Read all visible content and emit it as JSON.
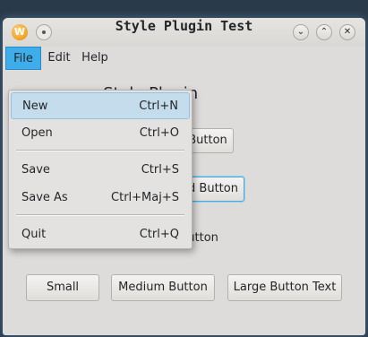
{
  "window": {
    "title": "Style Plugin Test",
    "app_icon_letter": "W"
  },
  "titlebar_buttons": {
    "minimize": "⌄",
    "maximize": "⌃",
    "close": "✕"
  },
  "menubar": [
    {
      "label": "File"
    },
    {
      "label": "Edit"
    },
    {
      "label": "Help"
    }
  ],
  "file_menu": [
    {
      "label": "New",
      "shortcut": "Ctrl+N"
    },
    {
      "label": "Open",
      "shortcut": "Ctrl+O"
    },
    {
      "label": "Save",
      "shortcut": "Ctrl+S"
    },
    {
      "label": "Save As",
      "shortcut": "Ctrl+Maj+S"
    },
    {
      "label": "Quit",
      "shortcut": "Ctrl+Q"
    }
  ],
  "content": {
    "heading_visible": "n Style Plugin",
    "button_1_visible": "Button",
    "button_2_visible": "d Button",
    "flat_button": "Flat Button"
  },
  "bottom_buttons": {
    "small": "Small",
    "medium": "Medium Button",
    "large": "Large Button Text"
  },
  "colors": {
    "accent": "#3daee9",
    "window_bg": "#dedcda"
  }
}
